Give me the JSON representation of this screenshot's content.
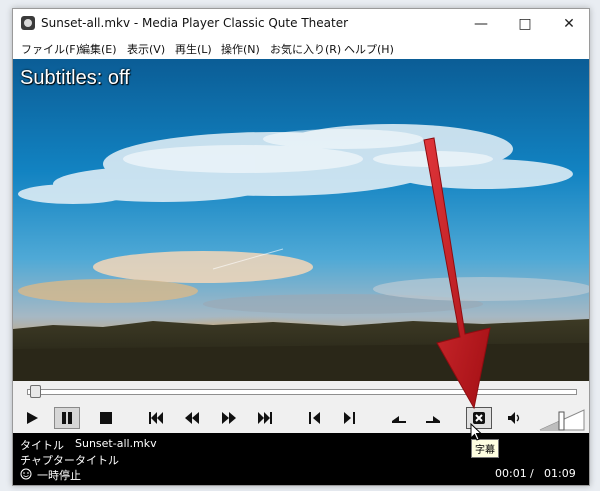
{
  "window": {
    "title": "Sunset-all.mkv - Media Player Classic Qute Theater"
  },
  "menu": [
    "ファイル(F)",
    "編集(E)",
    "表示(V)",
    "再生(L)",
    "操作(N)",
    "お気に入り(R)",
    "ヘルプ(H)"
  ],
  "osd": {
    "text": "Subtitles: off"
  },
  "seek": {
    "position_fraction": 0.015
  },
  "controls": {
    "icons": [
      "play-icon",
      "pause-icon",
      "stop-icon",
      "skip-back-icon",
      "rewind-icon",
      "fast-forward-icon",
      "skip-forward-icon",
      "frame-step-back-icon",
      "frame-step-forward-icon",
      "audio-track-icon",
      "subtitle-track-icon",
      "subtitles-toggle-icon",
      "speaker-icon"
    ],
    "subtitle_tooltip": "字幕"
  },
  "status": {
    "title_label": "タイトル",
    "title_value": "Sunset-all.mkv",
    "chapter_label": "チャプター",
    "chapter_value": "タイトル",
    "state": "一時停止",
    "time_current": "00:01",
    "time_separator": "/",
    "time_total": "01:09"
  },
  "colors": {
    "annotation_arrow": "#c8151b",
    "status_bg": "#000000"
  }
}
